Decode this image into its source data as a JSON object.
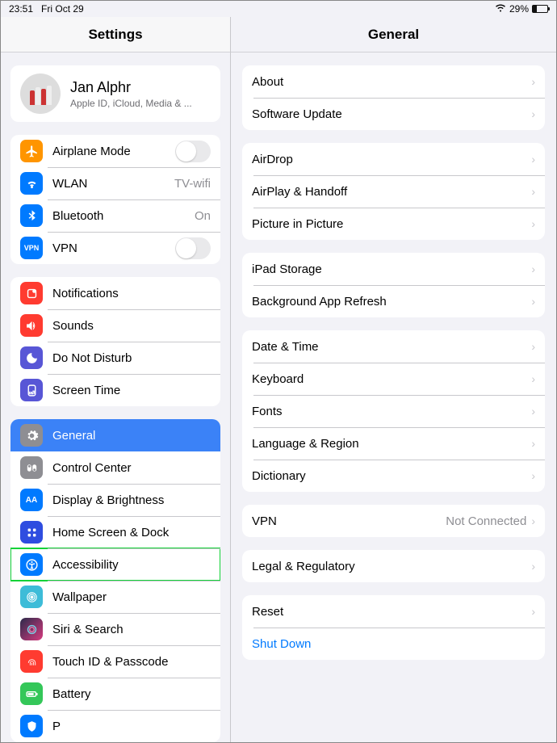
{
  "status": {
    "time": "23:51",
    "date": "Fri Oct 29",
    "battery": "29%"
  },
  "sidebar": {
    "title": "Settings",
    "appleid": {
      "name": "Jan Alphr",
      "sub": "Apple ID, iCloud, Media & ..."
    },
    "airplane": "Airplane Mode",
    "wlan": {
      "label": "WLAN",
      "value": "TV-wifi"
    },
    "bluetooth": {
      "label": "Bluetooth",
      "value": "On"
    },
    "vpn": "VPN",
    "notifications": "Notifications",
    "sounds": "Sounds",
    "dnd": "Do Not Disturb",
    "screentime": "Screen Time",
    "general": "General",
    "controlcenter": "Control Center",
    "display": "Display & Brightness",
    "home": "Home Screen & Dock",
    "accessibility": "Accessibility",
    "wallpaper": "Wallpaper",
    "siri": "Siri & Search",
    "touchid": "Touch ID & Passcode",
    "battery": "Battery",
    "privacy": "P"
  },
  "detail": {
    "title": "General",
    "about": "About",
    "software": "Software Update",
    "airdrop": "AirDrop",
    "airplay": "AirPlay & Handoff",
    "pip": "Picture in Picture",
    "storage": "iPad Storage",
    "refresh": "Background App Refresh",
    "datetime": "Date & Time",
    "keyboard": "Keyboard",
    "fonts": "Fonts",
    "language": "Language & Region",
    "dictionary": "Dictionary",
    "vpn": {
      "label": "VPN",
      "value": "Not Connected"
    },
    "legal": "Legal & Regulatory",
    "reset": "Reset",
    "shutdown": "Shut Down"
  },
  "colors": {
    "orange": "#ff9500",
    "blue": "#007aff",
    "purple": "#5856d6",
    "red": "#ff3b30",
    "darkblue": "#2f4de0",
    "gray": "#8e8e93",
    "green": "#34c759",
    "graydark": "#6f6f74",
    "pink": "#d63b7f"
  }
}
